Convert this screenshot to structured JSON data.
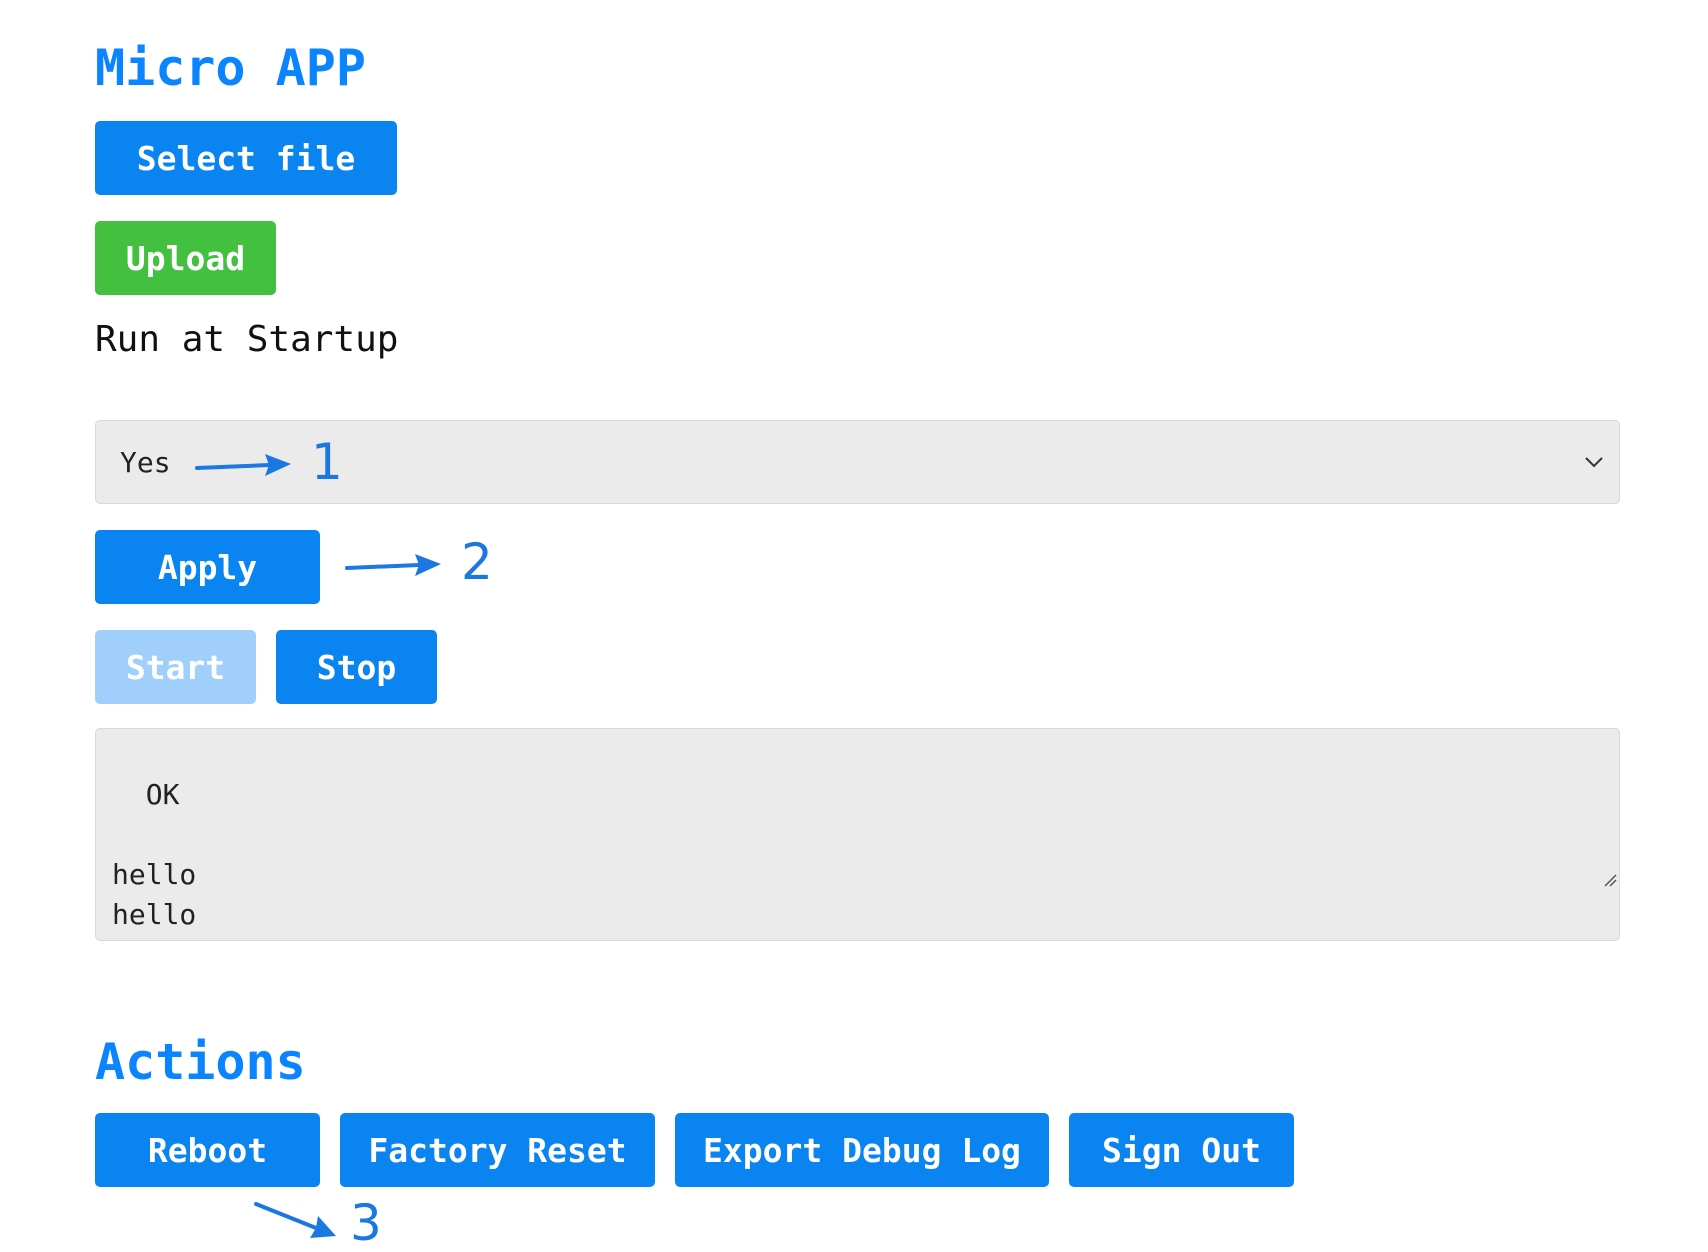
{
  "app": {
    "title": "Micro APP",
    "select_file_label": "Select file",
    "upload_label": "Upload",
    "run_at_startup_label": "Run at Startup",
    "startup_select": {
      "value": "Yes"
    },
    "apply_label": "Apply",
    "start_label": "Start",
    "stop_label": "Stop",
    "output_text": "OK\n\nhello\nhello"
  },
  "actions": {
    "title": "Actions",
    "reboot_label": "Reboot",
    "factory_reset_label": "Factory Reset",
    "export_debug_log_label": "Export Debug Log",
    "sign_out_label": "Sign Out"
  },
  "annotations": {
    "marker_1": "1",
    "marker_2": "2",
    "marker_3": "3"
  },
  "colors": {
    "primary": "#0a84f0",
    "title": "#0a84ff",
    "success": "#44c040",
    "disabled": "#a1cffb",
    "field_bg": "#ebebeb",
    "annotation": "#1a78e0"
  }
}
